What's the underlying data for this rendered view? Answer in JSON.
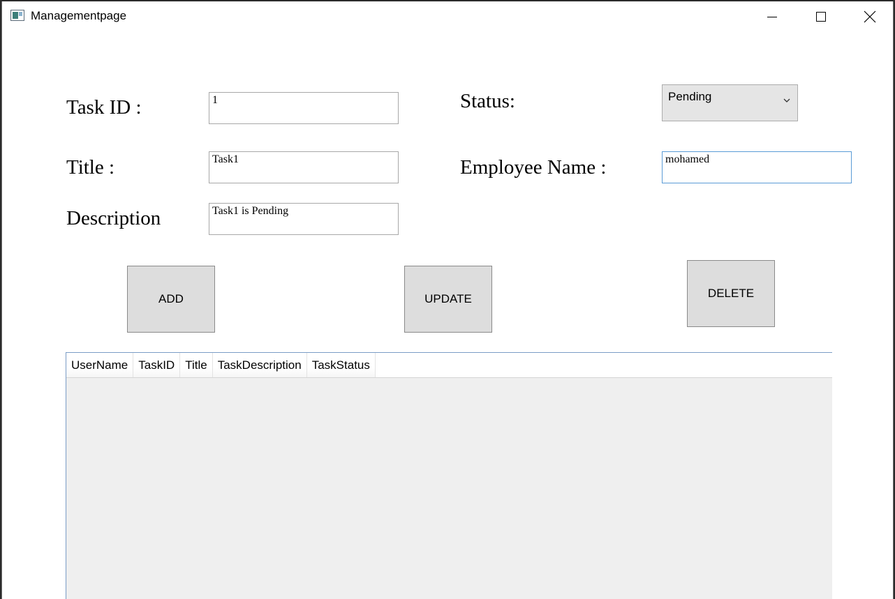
{
  "window": {
    "title": "Managementpage",
    "controls": {
      "minimize_icon": "minimize-icon",
      "maximize_icon": "maximize-icon",
      "close_icon": "close-icon"
    }
  },
  "form": {
    "task_id": {
      "label": "Task ID :",
      "value": "1"
    },
    "title": {
      "label": "Title :",
      "value": "Task1"
    },
    "description": {
      "label": "Description",
      "value": "Task1 is Pending"
    },
    "status": {
      "label": "Status:",
      "selected": "Pending",
      "icon": "chevron-down-icon"
    },
    "employee_name": {
      "label": "Employee Name :",
      "value": "mohamed"
    }
  },
  "buttons": {
    "add": "ADD",
    "update": "UPDATE",
    "delete": "DELETE"
  },
  "grid": {
    "columns": [
      "UserName",
      "TaskID",
      "Title",
      "TaskDescription",
      "TaskStatus"
    ],
    "rows": []
  },
  "colors": {
    "focus_border": "#5a9bd6",
    "button_bg": "#dddddd",
    "grid_border": "#7a9cc6",
    "grid_body": "#efefef"
  }
}
